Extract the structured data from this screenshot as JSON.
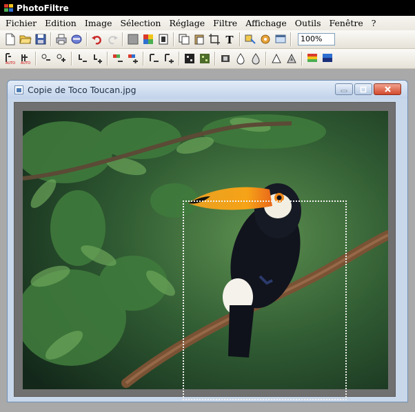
{
  "app": {
    "title": "PhotoFiltre",
    "brand_colors": [
      "#d93a2b",
      "#f0c419",
      "#4caf50",
      "#2f6fd0"
    ]
  },
  "menu": {
    "items": [
      "Fichier",
      "Edition",
      "Image",
      "Sélection",
      "Réglage",
      "Filtre",
      "Affichage",
      "Outils",
      "Fenêtre",
      "?"
    ]
  },
  "toolbar1": {
    "icons": [
      "new-file-icon",
      "open-folder-icon",
      "save-icon",
      "print-icon",
      "scan-icon",
      "undo-icon",
      "redo-icon",
      "grayscale-icon",
      "color-palette-icon",
      "image-size-icon",
      "copy-icon",
      "paste-icon",
      "crop-icon",
      "text-icon",
      "selection-tools-icon",
      "plugin-icon",
      "display-icon"
    ],
    "zoom_value": "100%"
  },
  "toolbar2": {
    "icons": [
      "auto-levels-icon",
      "auto-contrast-icon",
      "brightness-down-icon",
      "brightness-up-icon",
      "contrast-down-icon",
      "contrast-up-icon",
      "saturation-down-icon",
      "saturation-up-icon",
      "gamma-down-icon",
      "gamma-up-icon",
      "filter-blur-icon",
      "filter-sharpen-icon",
      "filter-emboss-icon",
      "filter-drop-icon",
      "filter-drop-alt-icon",
      "filter-sharpen-alt-icon",
      "filter-sharpen-more-icon",
      "color-swatch-icon",
      "color-swatch-alt-icon"
    ]
  },
  "document": {
    "title": "Copie de Toco Toucan.jpg"
  }
}
